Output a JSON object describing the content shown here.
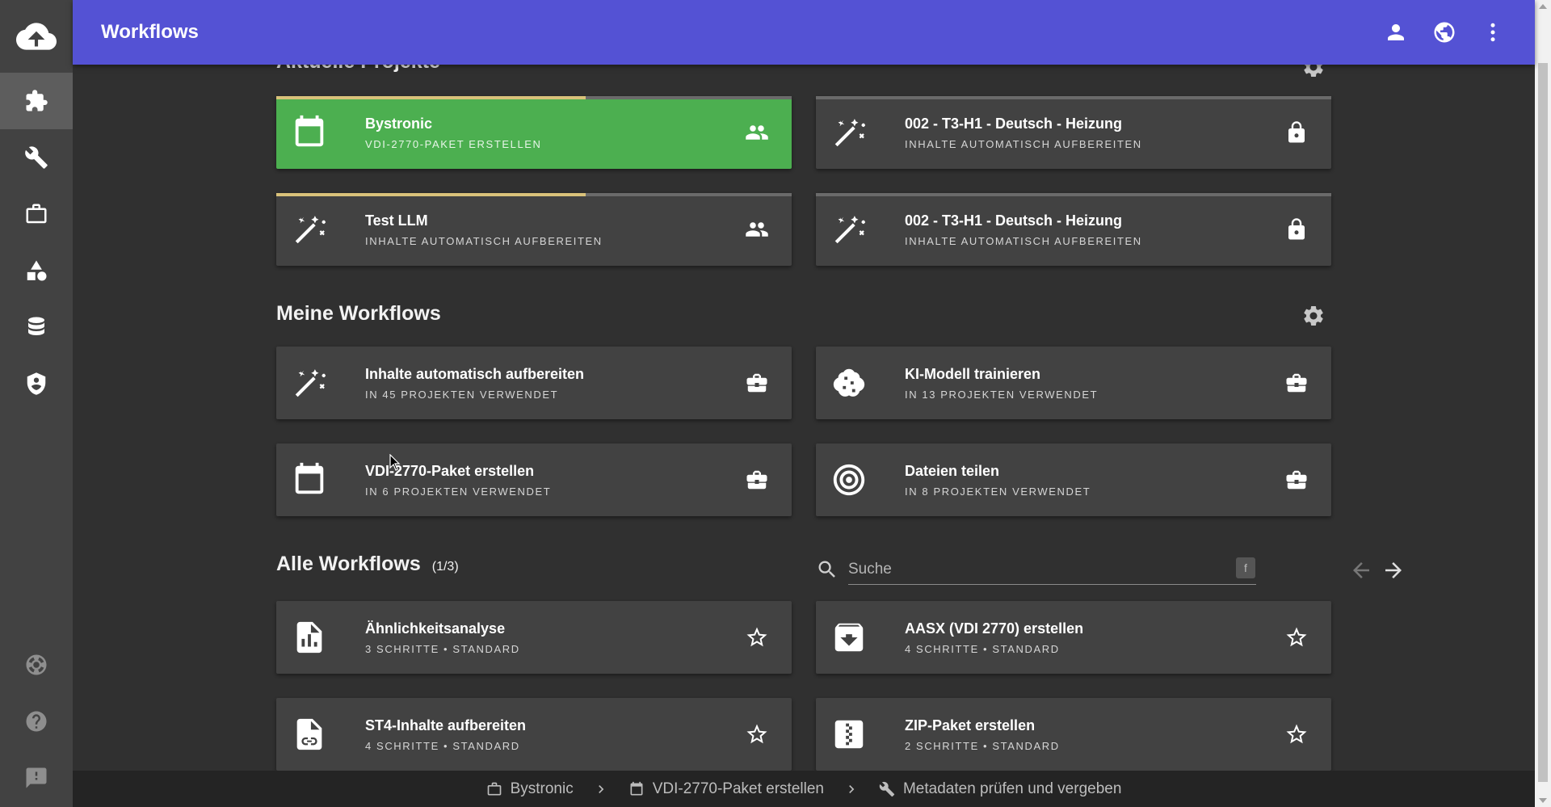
{
  "app": {
    "title": "Workflows"
  },
  "sidebar": {
    "items": [
      {
        "icon": "cloud-upload-icon"
      },
      {
        "icon": "puzzle-icon",
        "active": true
      },
      {
        "icon": "wrench-icon"
      },
      {
        "icon": "briefcase-icon"
      },
      {
        "icon": "shapes-icon"
      },
      {
        "icon": "database-icon"
      },
      {
        "icon": "shield-icon"
      },
      {
        "icon": "lifebuoy-icon"
      },
      {
        "icon": "help-icon"
      },
      {
        "icon": "feedback-icon"
      }
    ]
  },
  "header_actions": [
    "person-icon",
    "globe-icon",
    "more-vert-icon"
  ],
  "current_projects": {
    "title": "Aktuelle Projekte",
    "cards": [
      {
        "name": "Bystronic",
        "sub": "VDI-2770-PAKET ERSTELLEN",
        "icon": "calendar-icon",
        "right": "group-icon",
        "progress": 0.6,
        "highlight": true
      },
      {
        "name": "002 - T3-H1 - Deutsch - Heizung",
        "sub": "INHALTE AUTOMATISCH AUFBEREITEN",
        "icon": "magic-wand-icon",
        "right": "lock-icon",
        "progress": 0
      },
      {
        "name": "Test LLM",
        "sub": "INHALTE AUTOMATISCH AUFBEREITEN",
        "icon": "magic-wand-icon",
        "right": "group-icon",
        "progress": 0.6
      },
      {
        "name": "002 - T3-H1 - Deutsch - Heizung",
        "sub": "INHALTE AUTOMATISCH AUFBEREITEN",
        "icon": "magic-wand-icon",
        "right": "lock-icon",
        "progress": 0
      }
    ]
  },
  "my_workflows": {
    "title": "Meine Workflows",
    "cards": [
      {
        "name": "Inhalte automatisch aufbereiten",
        "sub": "IN 45 PROJEKTEN VERWENDET",
        "icon": "magic-wand-icon",
        "right": "briefcase-icon"
      },
      {
        "name": "KI-Modell trainieren",
        "sub": "IN 13 PROJEKTEN VERWENDET",
        "icon": "brain-icon",
        "right": "briefcase-icon"
      },
      {
        "name": "VDI-2770-Paket erstellen",
        "sub": "IN 6 PROJEKTEN VERWENDET",
        "icon": "calendar-icon",
        "right": "briefcase-icon"
      },
      {
        "name": "Dateien teilen",
        "sub": "IN 8 PROJEKTEN VERWENDET",
        "icon": "target-icon",
        "right": "briefcase-icon"
      }
    ]
  },
  "all_workflows": {
    "title": "Alle Workflows",
    "count": "(1/3)",
    "search_placeholder": "Suche",
    "search_key": "f",
    "cards": [
      {
        "name": "Ähnlichkeitsanalyse",
        "sub": "3 SCHRITTE • STANDARD",
        "icon": "chart-doc-icon",
        "right": "star-outline-icon"
      },
      {
        "name": "AASX (VDI 2770) erstellen",
        "sub": "4 SCHRITTE • STANDARD",
        "icon": "archive-icon",
        "right": "star-outline-icon"
      },
      {
        "name": "ST4-Inhalte aufbereiten",
        "sub": "4 SCHRITTE • STANDARD",
        "icon": "link-doc-icon",
        "right": "star-outline-icon"
      },
      {
        "name": "ZIP-Paket erstellen",
        "sub": "2 SCHRITTE • STANDARD",
        "icon": "zip-icon",
        "right": "star-outline-icon"
      }
    ]
  },
  "breadcrumb": [
    {
      "label": "Bystronic",
      "icon": "briefcase-outline-icon"
    },
    {
      "label": "VDI-2770-Paket erstellen",
      "icon": "calendar-icon"
    },
    {
      "label": "Metadaten prüfen und vergeben",
      "icon": "wrench-icon"
    }
  ],
  "colors": {
    "topbar": "#5452d4",
    "sidebar": "#424242",
    "background": "#303030",
    "card": "#424242",
    "highlight": "#4caf50",
    "progress": "#d9c27a"
  }
}
